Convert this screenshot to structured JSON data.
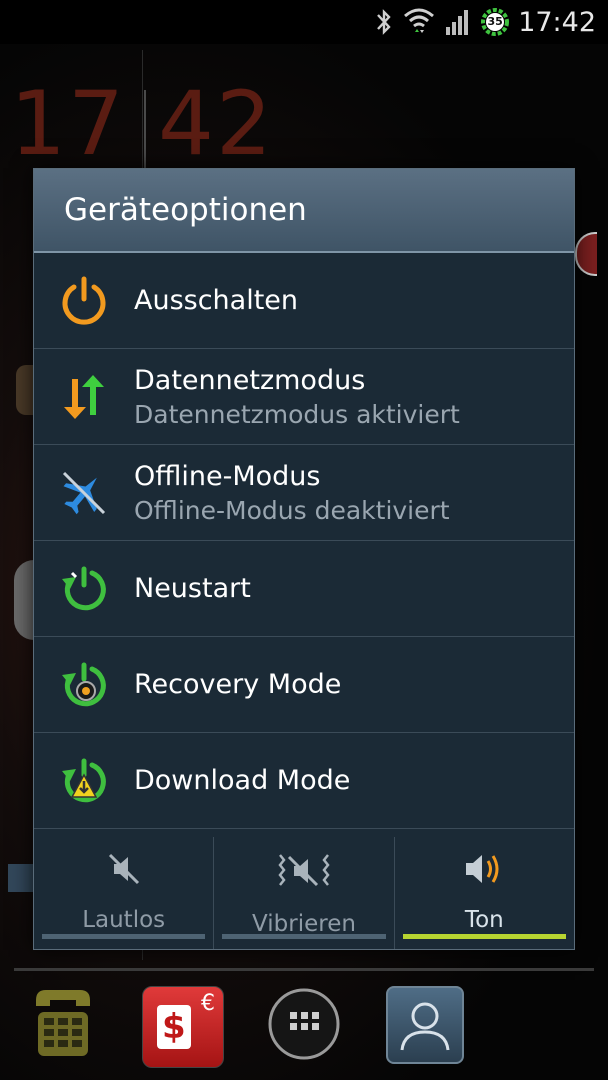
{
  "statusbar": {
    "time": "17:42",
    "battery_level": "35",
    "icons": [
      "bluetooth-icon",
      "wifi-icon",
      "signal-icon",
      "battery-icon"
    ]
  },
  "wallpaper": {
    "hour": "17",
    "minute": "42"
  },
  "dialog": {
    "title": "Geräteoptionen",
    "items": [
      {
        "label": "Ausschalten",
        "sub": "",
        "icon": "power-icon"
      },
      {
        "label": "Datennetzmodus",
        "sub": "Datennetzmodus aktiviert",
        "icon": "data-arrows-icon"
      },
      {
        "label": "Offline-Modus",
        "sub": "Offline-Modus deaktiviert",
        "icon": "airplane-off-icon"
      },
      {
        "label": "Neustart",
        "sub": "",
        "icon": "restart-icon"
      },
      {
        "label": "Recovery Mode",
        "sub": "",
        "icon": "recovery-icon"
      },
      {
        "label": "Download Mode",
        "sub": "",
        "icon": "download-mode-icon"
      }
    ],
    "sound_modes": [
      {
        "label": "Lautlos",
        "icon": "mute-icon",
        "active": false
      },
      {
        "label": "Vibrieren",
        "icon": "vibrate-icon",
        "active": false
      },
      {
        "label": "Ton",
        "icon": "speaker-icon",
        "active": true
      }
    ]
  },
  "colors": {
    "accent_active": "#b8d431",
    "power_orange": "#f29a1f",
    "restart_green": "#3fbf3f",
    "title_bar": "#4d6275",
    "dialog_bg": "#1b2a36"
  },
  "dock": {
    "items": [
      "phone-icon",
      "sparkasse-app-icon",
      "app-drawer-icon",
      "contacts-icon"
    ],
    "sparkasse_badge": "€"
  }
}
